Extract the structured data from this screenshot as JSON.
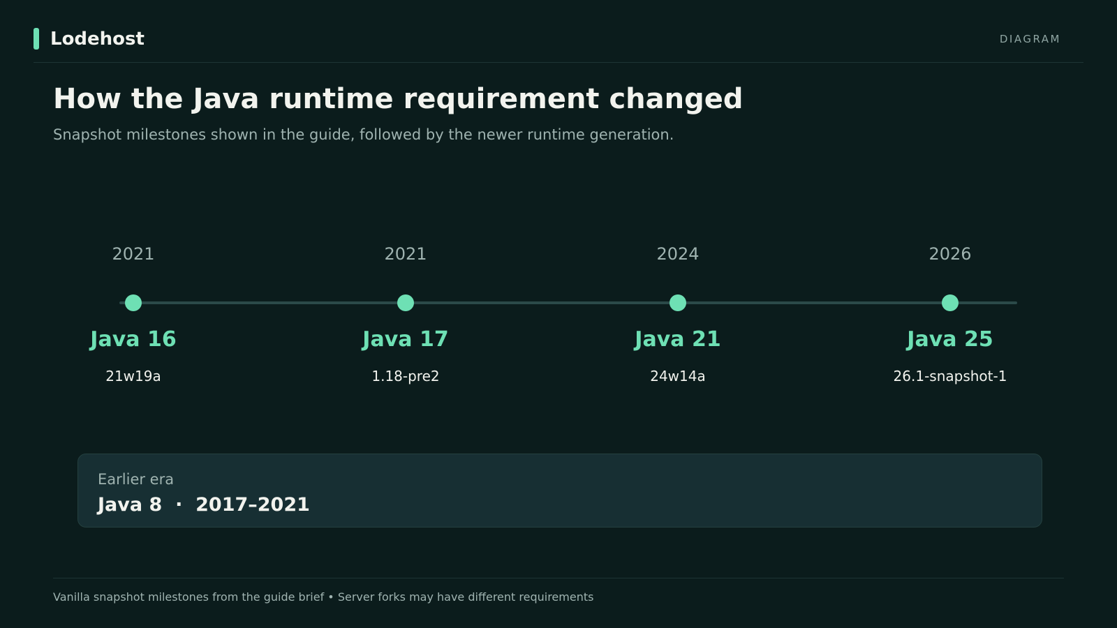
{
  "brand": {
    "name": "Lodehost"
  },
  "header": {
    "tag": "DIAGRAM"
  },
  "title": "How the Java runtime requirement changed",
  "subtitle": "Snapshot milestones shown in the guide, followed by the newer runtime generation.",
  "timeline": [
    {
      "year": "2021",
      "java": "Java 16",
      "version": "21w19a"
    },
    {
      "year": "2021",
      "java": "Java 17",
      "version": "1.18-pre2"
    },
    {
      "year": "2024",
      "java": "Java 21",
      "version": "24w14a"
    },
    {
      "year": "2026",
      "java": "Java 25",
      "version": "26.1-snapshot-1"
    }
  ],
  "era": {
    "label": "Earlier era",
    "value": "Java 8  ·  2017–2021"
  },
  "footer": "Vanilla snapshot milestones from the guide brief • Server forks may have different requirements",
  "colors": {
    "background": "#0b1c1c",
    "accent": "#6ee0b4",
    "card": "#172f33",
    "text": "#f2f3ee",
    "muted": "#9fb3b0"
  }
}
